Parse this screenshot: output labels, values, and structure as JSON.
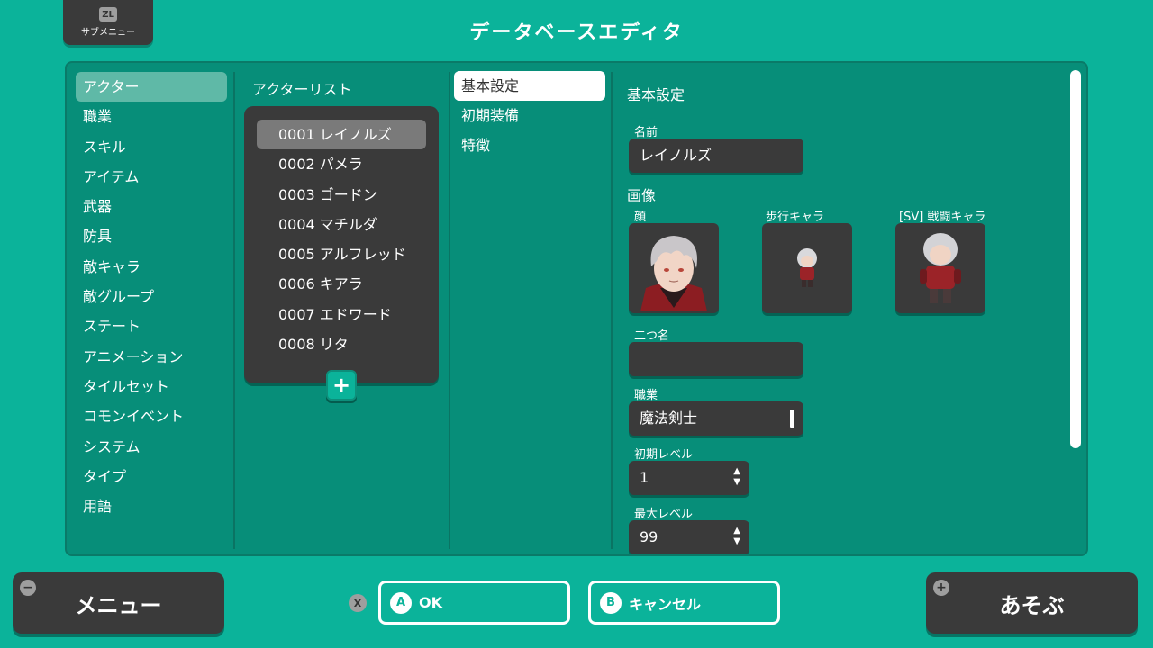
{
  "header": {
    "title": "データベースエディタ",
    "submenu_key": "ZL",
    "submenu_label": "サブメニュー"
  },
  "categories": [
    {
      "label": "アクター"
    },
    {
      "label": "職業"
    },
    {
      "label": "スキル"
    },
    {
      "label": "アイテム"
    },
    {
      "label": "武器"
    },
    {
      "label": "防具"
    },
    {
      "label": "敵キャラ"
    },
    {
      "label": "敵グループ"
    },
    {
      "label": "ステート"
    },
    {
      "label": "アニメーション"
    },
    {
      "label": "タイルセット"
    },
    {
      "label": "コモンイベント"
    },
    {
      "label": "システム"
    },
    {
      "label": "タイプ"
    },
    {
      "label": "用語"
    }
  ],
  "actor_list": {
    "title": "アクターリスト",
    "items": [
      {
        "label": "0001 レイノルズ"
      },
      {
        "label": "0002 パメラ"
      },
      {
        "label": "0003 ゴードン"
      },
      {
        "label": "0004 マチルダ"
      },
      {
        "label": "0005 アルフレッド"
      },
      {
        "label": "0006 キアラ"
      },
      {
        "label": "0007 エドワード"
      },
      {
        "label": "0008 リタ"
      }
    ],
    "add_label": "+"
  },
  "tabs": [
    {
      "label": "基本設定"
    },
    {
      "label": "初期装備"
    },
    {
      "label": "特徴"
    }
  ],
  "detail": {
    "section_title": "基本設定",
    "name_label": "名前",
    "name_value": "レイノルズ",
    "image_heading": "画像",
    "face_label": "顔",
    "walk_label": "歩行キャラ",
    "battler_label": "[SV] 戦闘キャラ",
    "nickname_label": "二つ名",
    "nickname_value": "",
    "class_label": "職業",
    "class_value": "魔法剣士",
    "initial_level_label": "初期レベル",
    "initial_level_value": "1",
    "max_level_label": "最大レベル",
    "max_level_value": "99"
  },
  "footer": {
    "menu_label": "メニュー",
    "menu_badge": "−",
    "x_badge": "X",
    "ok_key": "A",
    "ok_label": "OK",
    "cancel_key": "B",
    "cancel_label": "キャンセル",
    "play_label": "あそぶ",
    "play_badge": "+"
  },
  "colors": {
    "background": "#0bb39a",
    "panel": "#078e79",
    "button": "#3a3a3a"
  }
}
